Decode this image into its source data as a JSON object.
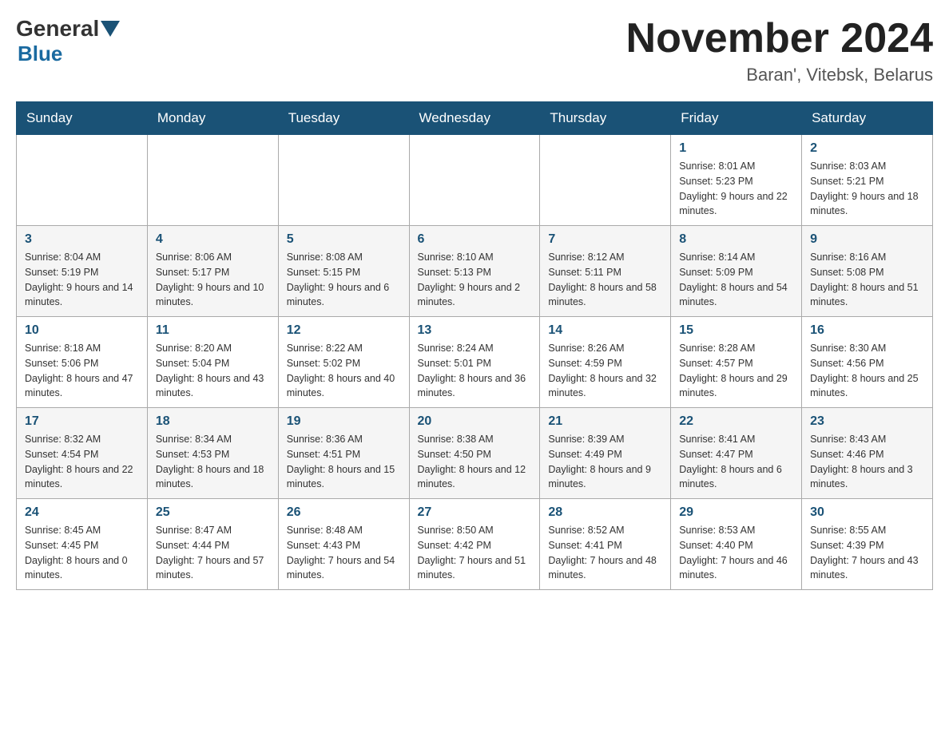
{
  "header": {
    "logo_general": "General",
    "logo_blue": "Blue",
    "month_title": "November 2024",
    "location": "Baran', Vitebsk, Belarus"
  },
  "weekdays": [
    "Sunday",
    "Monday",
    "Tuesday",
    "Wednesday",
    "Thursday",
    "Friday",
    "Saturday"
  ],
  "rows": [
    {
      "cells": [
        {
          "day": "",
          "empty": true
        },
        {
          "day": "",
          "empty": true
        },
        {
          "day": "",
          "empty": true
        },
        {
          "day": "",
          "empty": true
        },
        {
          "day": "",
          "empty": true
        },
        {
          "day": "1",
          "sunrise": "Sunrise: 8:01 AM",
          "sunset": "Sunset: 5:23 PM",
          "daylight": "Daylight: 9 hours and 22 minutes."
        },
        {
          "day": "2",
          "sunrise": "Sunrise: 8:03 AM",
          "sunset": "Sunset: 5:21 PM",
          "daylight": "Daylight: 9 hours and 18 minutes."
        }
      ]
    },
    {
      "cells": [
        {
          "day": "3",
          "sunrise": "Sunrise: 8:04 AM",
          "sunset": "Sunset: 5:19 PM",
          "daylight": "Daylight: 9 hours and 14 minutes."
        },
        {
          "day": "4",
          "sunrise": "Sunrise: 8:06 AM",
          "sunset": "Sunset: 5:17 PM",
          "daylight": "Daylight: 9 hours and 10 minutes."
        },
        {
          "day": "5",
          "sunrise": "Sunrise: 8:08 AM",
          "sunset": "Sunset: 5:15 PM",
          "daylight": "Daylight: 9 hours and 6 minutes."
        },
        {
          "day": "6",
          "sunrise": "Sunrise: 8:10 AM",
          "sunset": "Sunset: 5:13 PM",
          "daylight": "Daylight: 9 hours and 2 minutes."
        },
        {
          "day": "7",
          "sunrise": "Sunrise: 8:12 AM",
          "sunset": "Sunset: 5:11 PM",
          "daylight": "Daylight: 8 hours and 58 minutes."
        },
        {
          "day": "8",
          "sunrise": "Sunrise: 8:14 AM",
          "sunset": "Sunset: 5:09 PM",
          "daylight": "Daylight: 8 hours and 54 minutes."
        },
        {
          "day": "9",
          "sunrise": "Sunrise: 8:16 AM",
          "sunset": "Sunset: 5:08 PM",
          "daylight": "Daylight: 8 hours and 51 minutes."
        }
      ]
    },
    {
      "cells": [
        {
          "day": "10",
          "sunrise": "Sunrise: 8:18 AM",
          "sunset": "Sunset: 5:06 PM",
          "daylight": "Daylight: 8 hours and 47 minutes."
        },
        {
          "day": "11",
          "sunrise": "Sunrise: 8:20 AM",
          "sunset": "Sunset: 5:04 PM",
          "daylight": "Daylight: 8 hours and 43 minutes."
        },
        {
          "day": "12",
          "sunrise": "Sunrise: 8:22 AM",
          "sunset": "Sunset: 5:02 PM",
          "daylight": "Daylight: 8 hours and 40 minutes."
        },
        {
          "day": "13",
          "sunrise": "Sunrise: 8:24 AM",
          "sunset": "Sunset: 5:01 PM",
          "daylight": "Daylight: 8 hours and 36 minutes."
        },
        {
          "day": "14",
          "sunrise": "Sunrise: 8:26 AM",
          "sunset": "Sunset: 4:59 PM",
          "daylight": "Daylight: 8 hours and 32 minutes."
        },
        {
          "day": "15",
          "sunrise": "Sunrise: 8:28 AM",
          "sunset": "Sunset: 4:57 PM",
          "daylight": "Daylight: 8 hours and 29 minutes."
        },
        {
          "day": "16",
          "sunrise": "Sunrise: 8:30 AM",
          "sunset": "Sunset: 4:56 PM",
          "daylight": "Daylight: 8 hours and 25 minutes."
        }
      ]
    },
    {
      "cells": [
        {
          "day": "17",
          "sunrise": "Sunrise: 8:32 AM",
          "sunset": "Sunset: 4:54 PM",
          "daylight": "Daylight: 8 hours and 22 minutes."
        },
        {
          "day": "18",
          "sunrise": "Sunrise: 8:34 AM",
          "sunset": "Sunset: 4:53 PM",
          "daylight": "Daylight: 8 hours and 18 minutes."
        },
        {
          "day": "19",
          "sunrise": "Sunrise: 8:36 AM",
          "sunset": "Sunset: 4:51 PM",
          "daylight": "Daylight: 8 hours and 15 minutes."
        },
        {
          "day": "20",
          "sunrise": "Sunrise: 8:38 AM",
          "sunset": "Sunset: 4:50 PM",
          "daylight": "Daylight: 8 hours and 12 minutes."
        },
        {
          "day": "21",
          "sunrise": "Sunrise: 8:39 AM",
          "sunset": "Sunset: 4:49 PM",
          "daylight": "Daylight: 8 hours and 9 minutes."
        },
        {
          "day": "22",
          "sunrise": "Sunrise: 8:41 AM",
          "sunset": "Sunset: 4:47 PM",
          "daylight": "Daylight: 8 hours and 6 minutes."
        },
        {
          "day": "23",
          "sunrise": "Sunrise: 8:43 AM",
          "sunset": "Sunset: 4:46 PM",
          "daylight": "Daylight: 8 hours and 3 minutes."
        }
      ]
    },
    {
      "cells": [
        {
          "day": "24",
          "sunrise": "Sunrise: 8:45 AM",
          "sunset": "Sunset: 4:45 PM",
          "daylight": "Daylight: 8 hours and 0 minutes."
        },
        {
          "day": "25",
          "sunrise": "Sunrise: 8:47 AM",
          "sunset": "Sunset: 4:44 PM",
          "daylight": "Daylight: 7 hours and 57 minutes."
        },
        {
          "day": "26",
          "sunrise": "Sunrise: 8:48 AM",
          "sunset": "Sunset: 4:43 PM",
          "daylight": "Daylight: 7 hours and 54 minutes."
        },
        {
          "day": "27",
          "sunrise": "Sunrise: 8:50 AM",
          "sunset": "Sunset: 4:42 PM",
          "daylight": "Daylight: 7 hours and 51 minutes."
        },
        {
          "day": "28",
          "sunrise": "Sunrise: 8:52 AM",
          "sunset": "Sunset: 4:41 PM",
          "daylight": "Daylight: 7 hours and 48 minutes."
        },
        {
          "day": "29",
          "sunrise": "Sunrise: 8:53 AM",
          "sunset": "Sunset: 4:40 PM",
          "daylight": "Daylight: 7 hours and 46 minutes."
        },
        {
          "day": "30",
          "sunrise": "Sunrise: 8:55 AM",
          "sunset": "Sunset: 4:39 PM",
          "daylight": "Daylight: 7 hours and 43 minutes."
        }
      ]
    }
  ]
}
